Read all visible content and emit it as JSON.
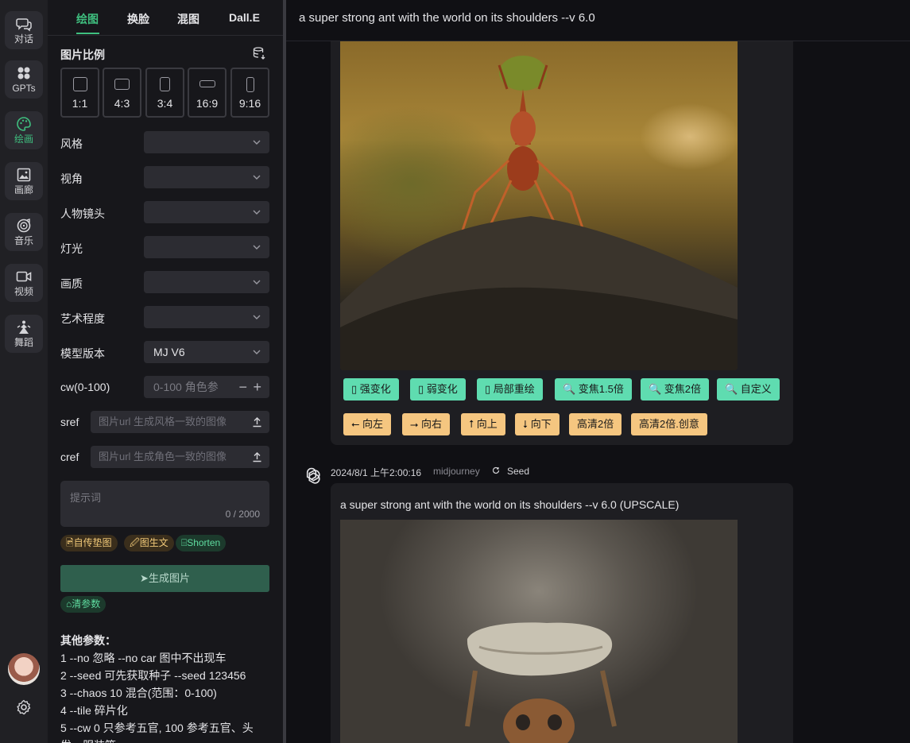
{
  "rail": {
    "items": [
      {
        "label": "对话",
        "icon": "chat-icon"
      },
      {
        "label": "GPTs",
        "icon": "apps-grid-icon"
      },
      {
        "label": "绘画",
        "icon": "palette-icon",
        "active": true
      },
      {
        "label": "画廊",
        "icon": "image-icon"
      },
      {
        "label": "音乐",
        "icon": "music-disc-icon"
      },
      {
        "label": "视频",
        "icon": "video-icon"
      },
      {
        "label": "舞蹈",
        "icon": "dance-icon"
      }
    ]
  },
  "tabs": [
    "绘图",
    "换脸",
    "混图",
    "Dall.E"
  ],
  "panel": {
    "ratio_title": "图片比例",
    "ratios": [
      "1:1",
      "4:3",
      "3:4",
      "16:9",
      "9:16"
    ],
    "rows": [
      {
        "label": "风格",
        "value": ""
      },
      {
        "label": "视角",
        "value": ""
      },
      {
        "label": "人物镜头",
        "value": ""
      },
      {
        "label": "灯光",
        "value": ""
      },
      {
        "label": "画质",
        "value": ""
      },
      {
        "label": "艺术程度",
        "value": ""
      },
      {
        "label": "模型版本",
        "value": "MJ V6"
      }
    ],
    "cw_label": "cw(0-100)",
    "cw_placeholder": "0-100 角色参",
    "cw_minus": "−",
    "cw_plus": "+",
    "sref_label": "sref",
    "sref_placeholder": "图片url 生成风格一致的图像",
    "cref_label": "cref",
    "cref_placeholder": "图片url 生成角色一致的图像",
    "prompt_placeholder": "提示词",
    "prompt_count": "0 / 2000",
    "chips": [
      "🖻自传垫图",
      "🖉图生文",
      "⌸Shorten"
    ],
    "generate_label": "➤生成图片",
    "clear_label": "⌂清参数",
    "notes_title": "其他参数：",
    "notes": [
      "1 --no 忽略 --no car 图中不出现车",
      "2 --seed 可先获取种子 --seed 123456",
      "3 --chaos 10 混合(范围：0-100)",
      "4 --tile 碎片化",
      "5 --cw 0 只参考五官, 100 参考五官、头",
      "发、服装等"
    ]
  },
  "main": {
    "title": "a super strong ant with the world on its shoulders --v 6.0",
    "actions_row1": [
      "▯ 强变化",
      "▯ 弱变化",
      "▯ 局部重绘",
      "🔍 变焦1.5倍",
      "🔍 变焦2倍",
      "🔍 自定义"
    ],
    "actions_row2": [
      "⭠ 向左",
      "⭢ 向右",
      "⭡ 向上",
      "⭣ 向下",
      "高清2倍",
      "高清2倍.创意"
    ],
    "meta_time": "2024/8/1 上午2:00:16",
    "meta_source": "midjourney",
    "meta_seed": "Seed",
    "caption2": "a super strong ant with the world on its shoulders --v 6.0 (UPSCALE)"
  },
  "colors": {
    "accent": "#3fbf7f",
    "action_green": "#5fdcb0",
    "action_yellow": "#f5c680"
  }
}
